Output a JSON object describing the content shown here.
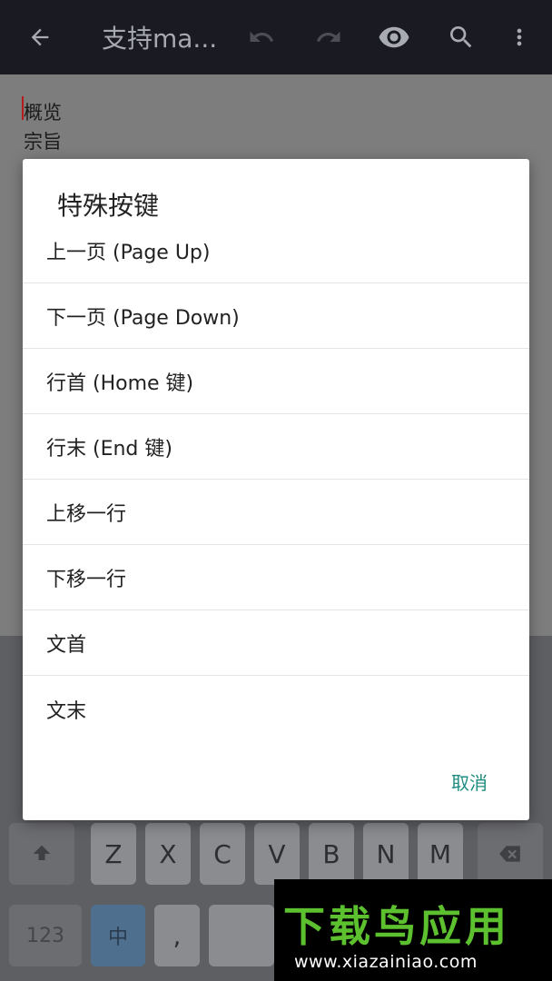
{
  "appbar": {
    "title": "支持ma...",
    "back_icon": "arrow-left-icon",
    "undo_icon": "undo-icon",
    "redo_icon": "redo-icon",
    "eye_icon": "eye-icon",
    "search_icon": "search-icon",
    "more_icon": "more-vert-icon"
  },
  "editor": {
    "lines": [
      "概览",
      "宗旨"
    ]
  },
  "dialog": {
    "title": "特殊按键",
    "items": [
      "上一页 (Page Up)",
      "下一页 (Page Down)",
      "行首 (Home 键)",
      "行末 (End 键)",
      "上移一行",
      "下移一行",
      "文首",
      "文末"
    ],
    "cancel": "取消"
  },
  "keyboard": {
    "letters": [
      "Z",
      "X",
      "C",
      "V",
      "B",
      "N",
      "M"
    ],
    "num_key": "123",
    "lang_key": "中",
    "comma_key": ","
  },
  "watermark": {
    "text": "下载鸟应用",
    "url": "www.xiazainiao.com"
  },
  "colors": {
    "appbar_bg": "#1a1b22",
    "accent": "#1e8c83",
    "watermark_green": "#5cc02f"
  }
}
